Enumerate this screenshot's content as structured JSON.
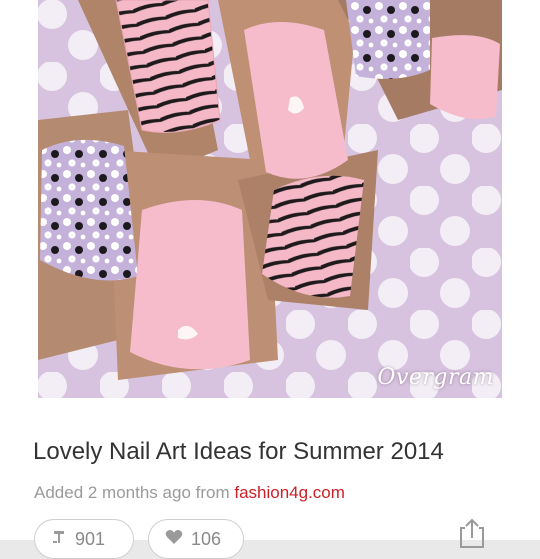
{
  "pin": {
    "title": "Lovely Nail Art Ideas for Summer 2014",
    "added_prefix": "Added 2 months ago from ",
    "source": "fashion4g.com",
    "watermark": "Overgram",
    "repin_count": "901",
    "like_count": "106"
  },
  "icons": {
    "repin": "repin-icon",
    "like": "heart-icon",
    "share": "share-icon"
  },
  "colors": {
    "source_link": "#cb1f27",
    "nail_pink": "#f6b9c8",
    "nail_lilac": "#c8b6dd",
    "background_lilac": "#d9c6e0"
  }
}
